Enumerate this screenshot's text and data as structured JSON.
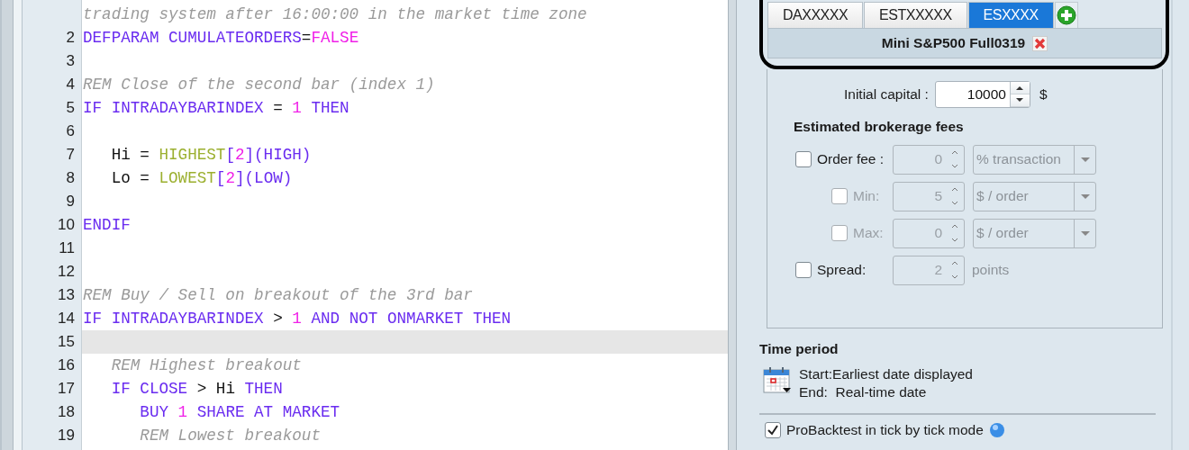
{
  "editor": {
    "lines": [
      {
        "current": false,
        "tokens": [
          {
            "kind": "comment",
            "text": "trading system after 16:00:00 in the market time zone"
          }
        ]
      },
      {
        "number": "2",
        "current": false,
        "tokens": [
          {
            "kind": "keyword",
            "text": "DEFPARAM CUMULATEORDERS"
          },
          {
            "kind": "plain",
            "text": "="
          },
          {
            "kind": "number",
            "text": "FALSE"
          }
        ]
      },
      {
        "number": "3",
        "current": false
      },
      {
        "number": "4",
        "current": false,
        "tokens": [
          {
            "kind": "comment",
            "text": "REM Close of the second bar (index 1)"
          }
        ]
      },
      {
        "number": "5",
        "current": false,
        "tokens": [
          {
            "kind": "keyword",
            "text": "IF INTRADAYBARINDEX "
          },
          {
            "kind": "plain",
            "text": "= "
          },
          {
            "kind": "number",
            "text": "1"
          },
          {
            "kind": "keyword",
            "text": " THEN"
          }
        ]
      },
      {
        "number": "6",
        "current": false
      },
      {
        "number": "7",
        "current": false,
        "tokens": [
          {
            "kind": "plain",
            "text": "   Hi = "
          },
          {
            "kind": "function",
            "text": "HIGHEST"
          },
          {
            "kind": "keyword",
            "text": "["
          },
          {
            "kind": "number",
            "text": "2"
          },
          {
            "kind": "keyword",
            "text": "](HIGH)"
          }
        ]
      },
      {
        "number": "8",
        "current": false,
        "tokens": [
          {
            "kind": "plain",
            "text": "   Lo = "
          },
          {
            "kind": "function",
            "text": "LOWEST"
          },
          {
            "kind": "keyword",
            "text": "["
          },
          {
            "kind": "number",
            "text": "2"
          },
          {
            "kind": "keyword",
            "text": "](LOW)"
          }
        ]
      },
      {
        "number": "9",
        "current": false
      },
      {
        "number": "10",
        "current": false,
        "tokens": [
          {
            "kind": "keyword",
            "text": "ENDIF"
          }
        ]
      },
      {
        "number": "11",
        "current": false
      },
      {
        "number": "12",
        "current": false
      },
      {
        "number": "13",
        "current": false,
        "tokens": [
          {
            "kind": "comment",
            "text": "REM Buy / Sell on breakout of the 3rd bar"
          }
        ]
      },
      {
        "number": "14",
        "current": false,
        "tokens": [
          {
            "kind": "keyword",
            "text": "IF INTRADAYBARINDEX "
          },
          {
            "kind": "plain",
            "text": "> "
          },
          {
            "kind": "number",
            "text": "1"
          },
          {
            "kind": "keyword",
            "text": " AND NOT ONMARKET THEN"
          }
        ]
      },
      {
        "number": "15",
        "current": true
      },
      {
        "number": "16",
        "current": false,
        "tokens": [
          {
            "kind": "comment",
            "text": "   REM Highest breakout"
          }
        ]
      },
      {
        "number": "17",
        "current": false,
        "tokens": [
          {
            "kind": "keyword",
            "text": "   IF CLOSE "
          },
          {
            "kind": "plain",
            "text": "> Hi "
          },
          {
            "kind": "keyword",
            "text": "THEN"
          }
        ]
      },
      {
        "number": "18",
        "current": false,
        "tokens": [
          {
            "kind": "keyword",
            "text": "      BUY "
          },
          {
            "kind": "number",
            "text": "1"
          },
          {
            "kind": "keyword",
            "text": " SHARE AT MARKET"
          }
        ]
      },
      {
        "number": "19",
        "current": false,
        "tokens": [
          {
            "kind": "comment",
            "text": "      REM Lowest breakout"
          }
        ]
      }
    ]
  },
  "panel": {
    "tabs": [
      {
        "label": "DAXXXXX",
        "selected": false
      },
      {
        "label": "ESTXXXXX",
        "selected": false
      },
      {
        "label": "ESXXXX",
        "selected": true
      }
    ],
    "instrument": "Mini S&P500 Full0319",
    "capital": {
      "label": "Initial capital :",
      "value": "10000",
      "unit": "$"
    },
    "fees_title": "Estimated brokerage fees",
    "fees": [
      {
        "kind": "main",
        "label": "Order fee :",
        "checked": false,
        "disabled": false,
        "value": "0",
        "unit": "% transaction"
      },
      {
        "kind": "sub",
        "label": "Min:",
        "checked": false,
        "disabled": true,
        "value": "5",
        "unit": "$ / order"
      },
      {
        "kind": "sub",
        "label": "Max:",
        "checked": false,
        "disabled": true,
        "value": "0",
        "unit": "$ / order"
      },
      {
        "kind": "main",
        "label": "Spread:",
        "checked": false,
        "disabled": false,
        "value": "2",
        "suffix": "points"
      }
    ],
    "time_title": "Time period",
    "start": "Start:Earliest date displayed",
    "end": "End:  Real-time date",
    "tick_mode": {
      "label": "ProBacktest in tick by tick mode",
      "checked": true
    }
  }
}
